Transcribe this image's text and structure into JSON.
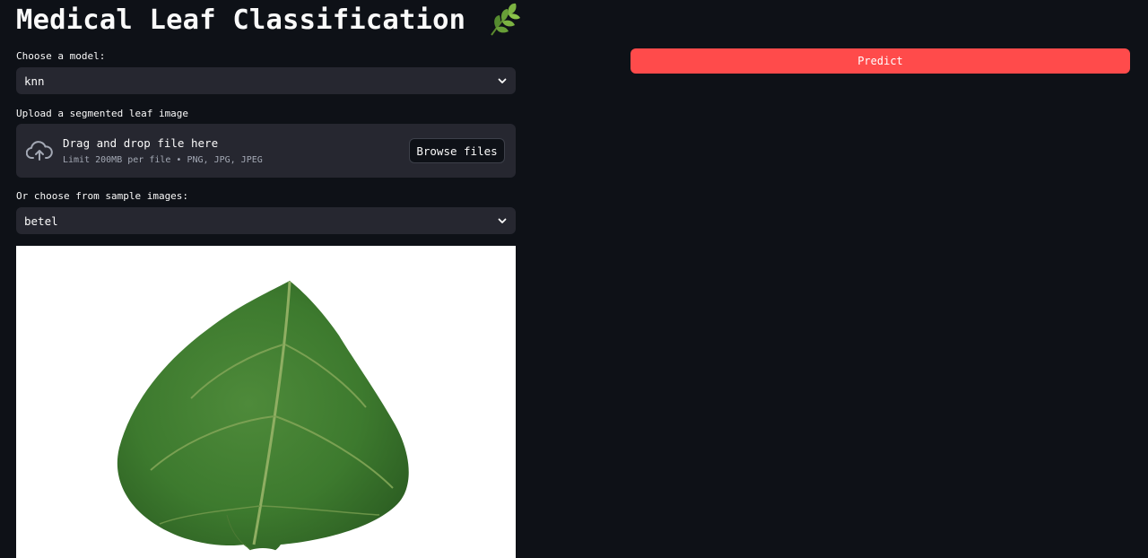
{
  "page": {
    "title": "Medical Leaf Classification",
    "title_icon": "herb-leaf-icon"
  },
  "model_select": {
    "label": "Choose a model:",
    "value": "knn"
  },
  "uploader": {
    "label": "Upload a segmented leaf image",
    "main_text": "Drag and drop file here",
    "sub_text": "Limit 200MB per file • PNG, JPG, JPEG",
    "button_label": "Browse files",
    "icon": "cloud-upload-icon"
  },
  "sample_select": {
    "label": "Or choose from sample images:",
    "value": "betel"
  },
  "sample_image": {
    "subject": "betel-leaf-image"
  },
  "predict_button": {
    "label": "Predict",
    "color": "#ff4b4b"
  },
  "theme": {
    "background": "#0e1117",
    "widget_background": "#262730",
    "text": "#fafafa"
  }
}
